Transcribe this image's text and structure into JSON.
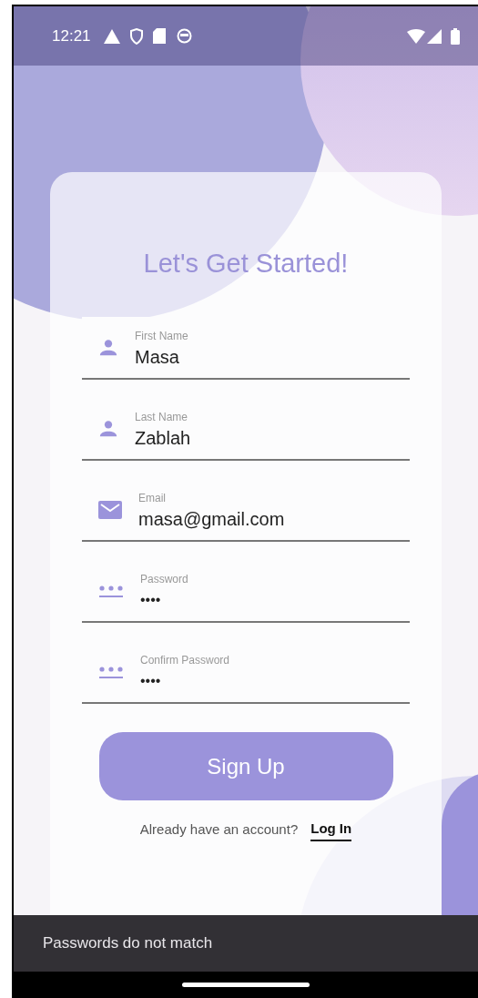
{
  "status_bar": {
    "time": "12:21"
  },
  "title": "Let's Get Started!",
  "fields": [
    {
      "kind": "person",
      "label": "First Name",
      "value": "Masa"
    },
    {
      "kind": "person",
      "label": "Last Name",
      "value": "Zablah"
    },
    {
      "kind": "email",
      "label": "Email",
      "value": "masa@gmail.com"
    },
    {
      "kind": "password",
      "label": "Password",
      "value": "••••"
    },
    {
      "kind": "password",
      "label": "Confirm Password",
      "value": "••••"
    }
  ],
  "submit_button": "Sign Up",
  "login_prompt": {
    "text": "Already have an account?",
    "link": "Log In"
  },
  "snackbar": "Passwords do not match"
}
